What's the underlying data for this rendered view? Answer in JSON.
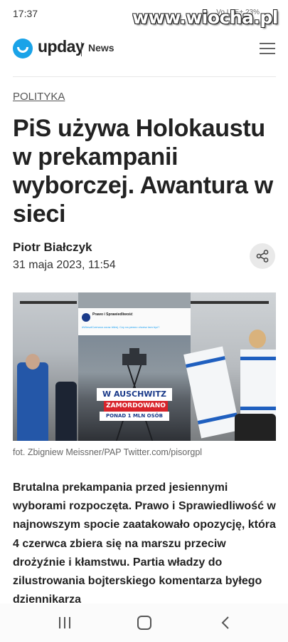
{
  "status_bar": {
    "time": "17:37",
    "indicators": "Vo LTE+ 23%",
    "watermark": "www.wiocha.pl"
  },
  "header": {
    "logo_text": "upday",
    "section": "News",
    "logo_color": "#1aa3e8",
    "menu_icon": "hamburger-menu-icon"
  },
  "article": {
    "category": "POLITYKA",
    "headline": "PiS używa Holokaustu w prekampanii wyborczej. Awantura w sieci",
    "author": "Piotr Białczyk",
    "date": "31 maja 2023, 11:54",
    "share_icon": "share-icon",
    "image": {
      "banner_line1": "W AUSCHWITZ",
      "banner_line2": "ZAMORDOWANO",
      "banner_line3": "PONAD 1 MLN OSÓB",
      "post_author": "Prawo i Sprawiedliwość",
      "post_text": "#WiesztCzerwca coraz bliżej. Czy na pewno chcesz tam być?"
    },
    "caption": "fot. Zbigniew Meissner/PAP Twitter.com/pisorgpl",
    "body": "Brutalna prekampania przed jesiennymi wyborami rozpoczęta. Prawo i Sprawiedliwość w najnowszym spocie zaatakowało opozycję, która 4 czerwca zbiera się na marszu przeciw drożyźnie i kłamstwu. Partia władzy do zilustrowania bojterskiego komentarza byłego dziennikarza"
  },
  "nav_bar": {
    "recent_icon": "recent-apps-icon",
    "home_icon": "home-icon",
    "back_icon": "back-icon"
  }
}
